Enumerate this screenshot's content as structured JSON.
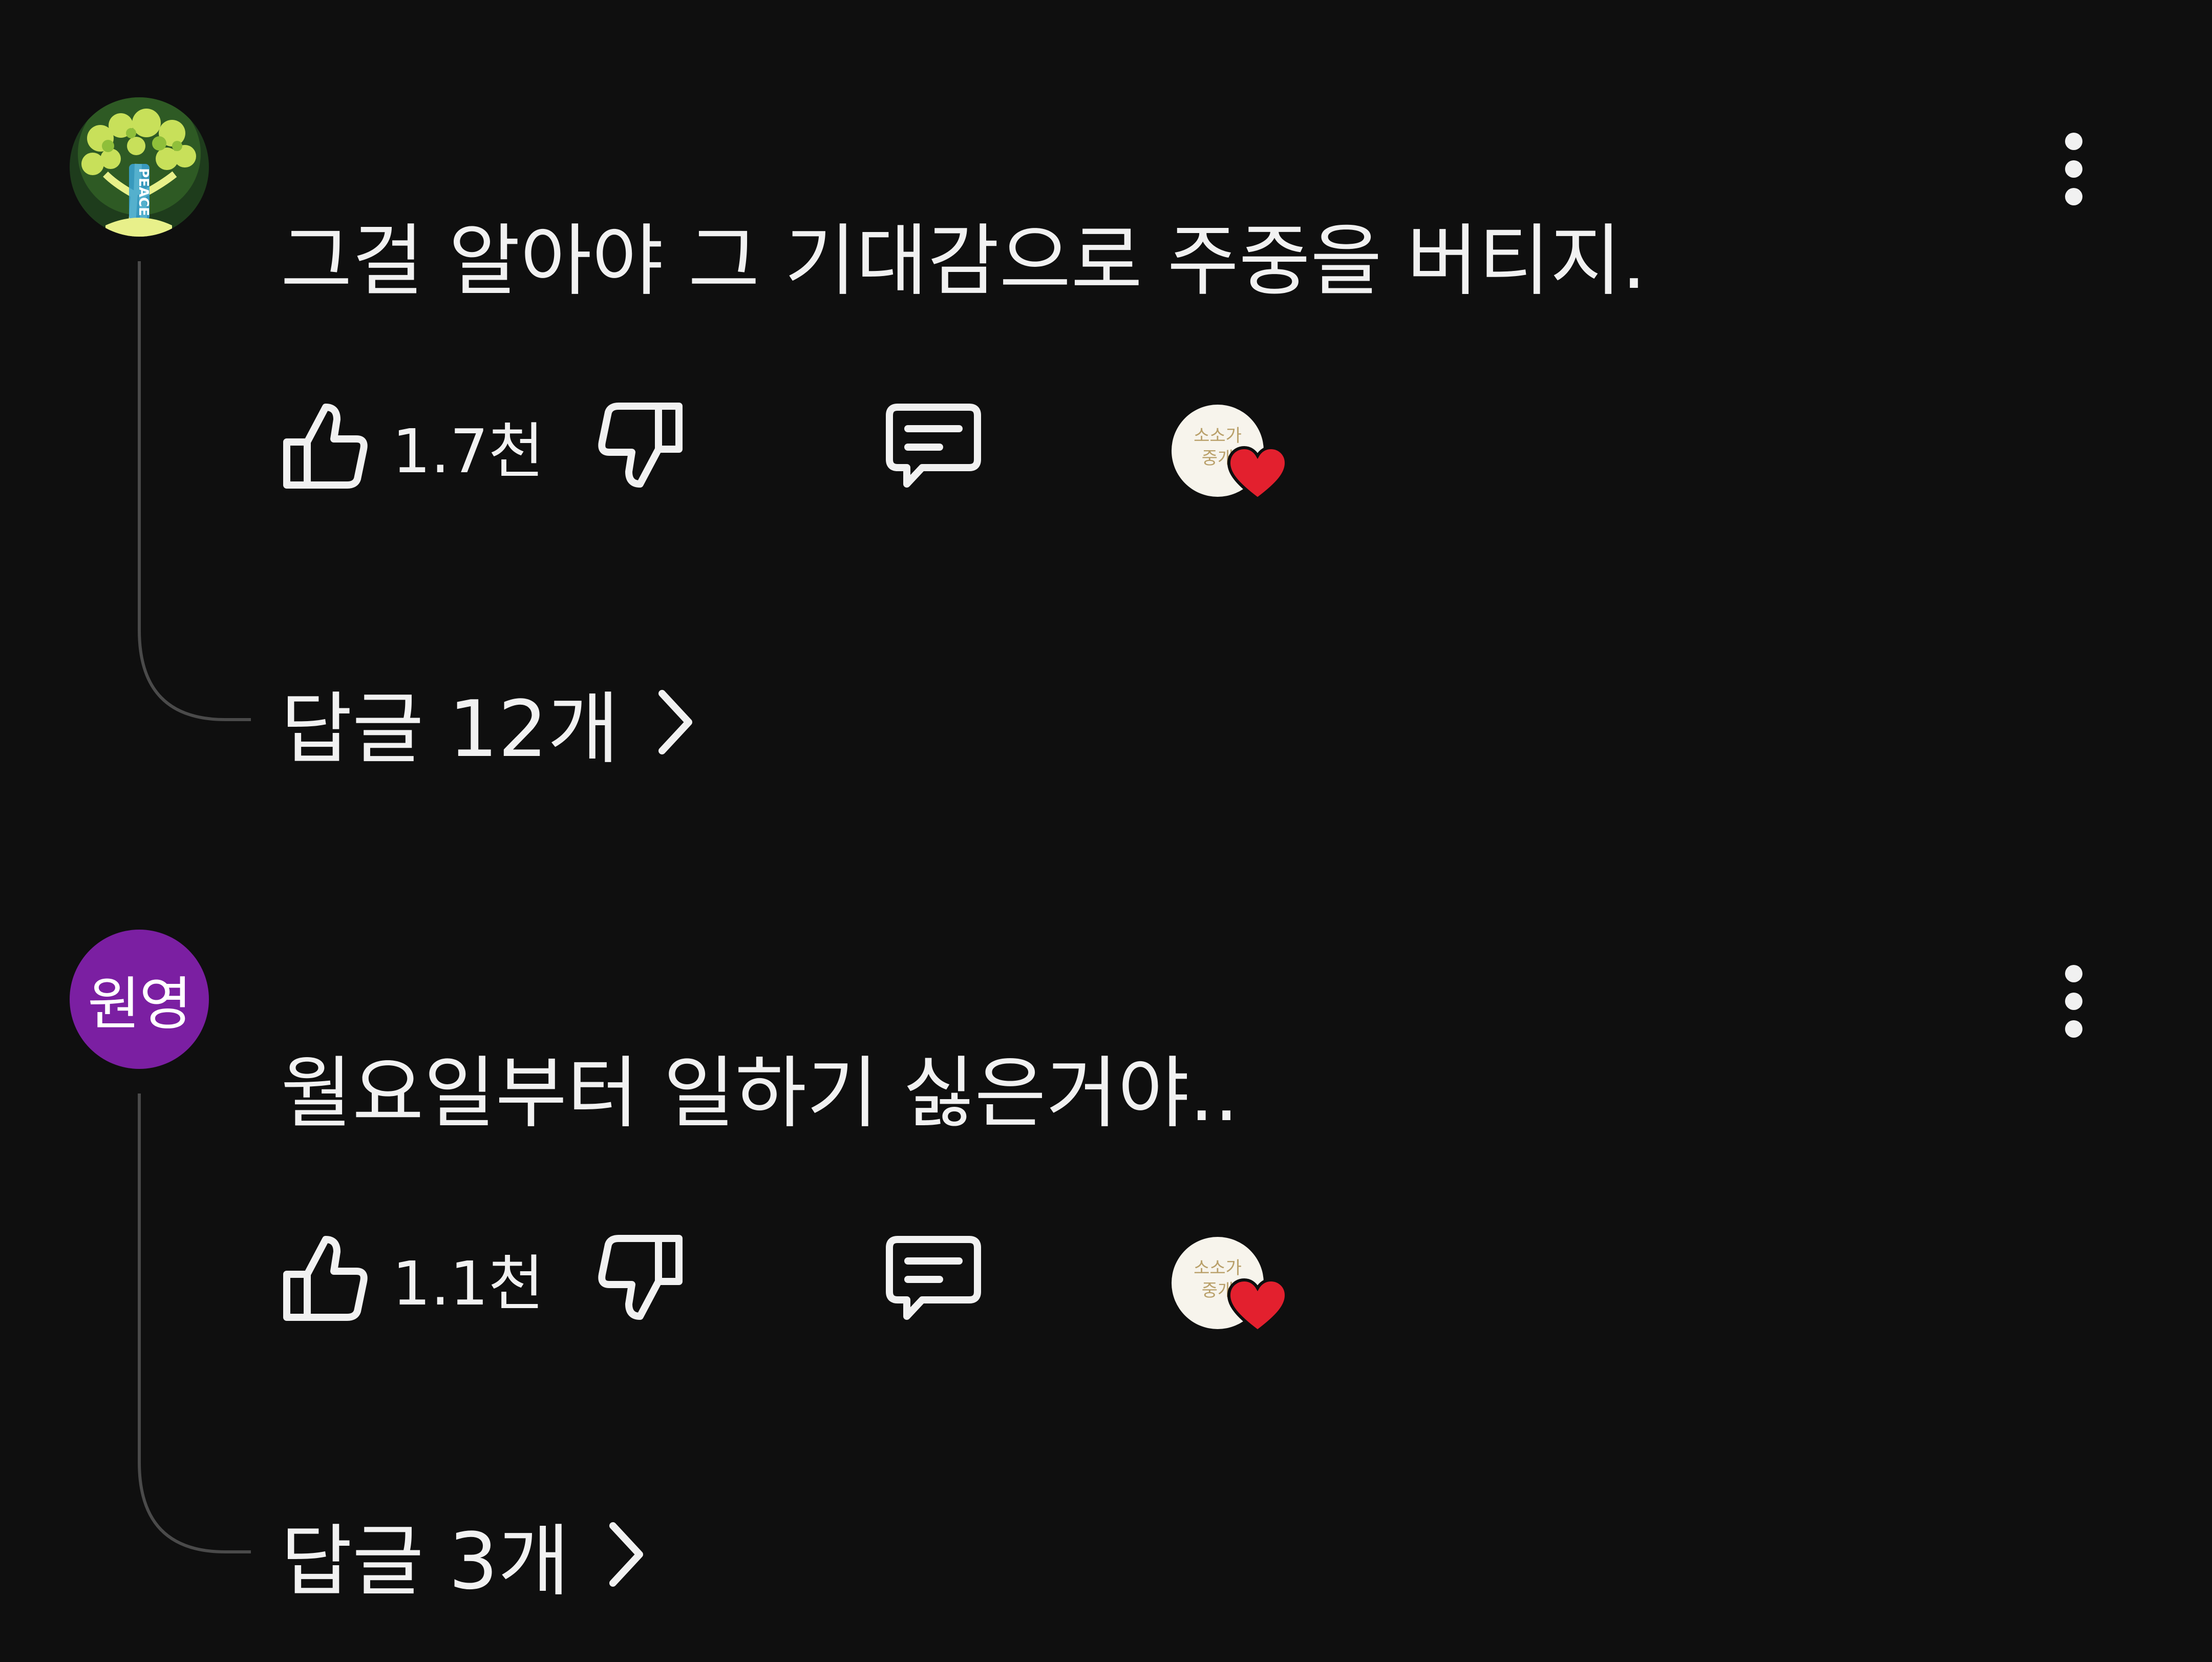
{
  "comments": [
    {
      "avatar_icon": "tree-peace-avatar",
      "avatar_label": "PEACE",
      "text": "그걸 알아야 그 기대감으로 주중을 버티지.",
      "like_count": "1.7천",
      "replies_label": "답글 12개",
      "creator_avatar_text": [
        "소소가",
        "중개"
      ]
    },
    {
      "avatar_icon": "initials-avatar",
      "avatar_label": "원영",
      "avatar_color": "#7b1fa2",
      "text": "월요일부터 일하기 싫은거야..",
      "like_count": "1.1천",
      "replies_label": "답글 3개",
      "creator_avatar_text": [
        "소소가",
        "중개"
      ]
    }
  ],
  "icons": {
    "like": "thumbs-up-icon",
    "dislike": "thumbs-down-icon",
    "reply": "reply-comment-icon",
    "creator_heart": "heart-icon",
    "more": "more-vertical-icon",
    "chevron": "chevron-right-icon"
  },
  "colors": {
    "background": "#0f0f0f",
    "text": "#f1f1f1",
    "heart": "#e3202e",
    "avatar_purple": "#7b1fa2"
  }
}
